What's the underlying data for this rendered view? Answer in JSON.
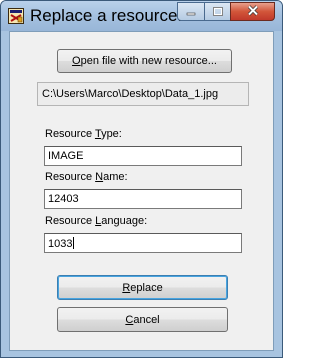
{
  "window": {
    "title": "Replace a resource..."
  },
  "icons": {
    "app": "resource-app-icon",
    "minimize": "minimize-icon",
    "maximize": "maximize-icon",
    "close": "close-icon"
  },
  "buttons": {
    "open_file": {
      "before": "",
      "mnemonic": "O",
      "after": "pen file with new resource..."
    },
    "replace": {
      "before": "",
      "mnemonic": "R",
      "after": "eplace"
    },
    "cancel": {
      "before": "",
      "mnemonic": "C",
      "after": "ancel"
    }
  },
  "file_path": "C:\\Users\\Marco\\Desktop\\Data_1.jpg",
  "fields": {
    "type": {
      "before": "Resource ",
      "mnemonic": "T",
      "after": "ype:",
      "value": "IMAGE"
    },
    "name": {
      "before": "Resource ",
      "mnemonic": "N",
      "after": "ame:",
      "value": "12403"
    },
    "language": {
      "before": "Resource ",
      "mnemonic": "L",
      "after": "anguage:",
      "value": "1033"
    }
  }
}
